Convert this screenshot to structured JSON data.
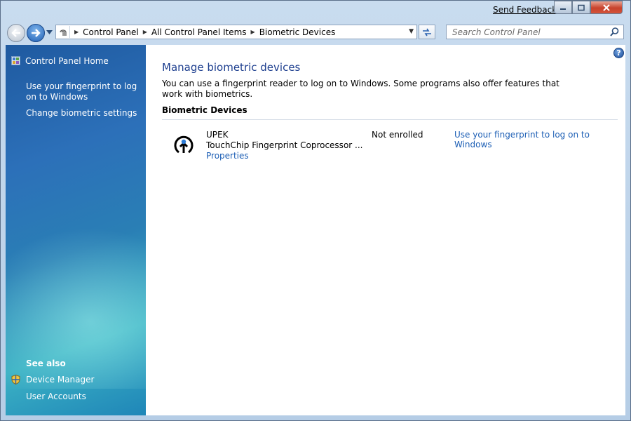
{
  "titlebar": {
    "feedback_label": "Send Feedback"
  },
  "addressbar": {
    "breadcrumbs": [
      "Control Panel",
      "All Control Panel Items",
      "Biometric Devices"
    ]
  },
  "search": {
    "placeholder": "Search Control Panel"
  },
  "sidebar": {
    "home_label": "Control Panel Home",
    "links": [
      "Use your fingerprint to log on to Windows",
      "Change biometric settings"
    ],
    "see_also_heading": "See also",
    "see_also": [
      "Device Manager",
      "User Accounts"
    ]
  },
  "main": {
    "title": "Manage biometric devices",
    "description": "You can use a fingerprint reader to log on to Windows. Some programs also offer features that work with biometrics.",
    "section_heading": "Biometric Devices",
    "device": {
      "vendor": "UPEK",
      "model": "TouchChip Fingerprint Coprocessor ...",
      "properties_label": "Properties",
      "status": "Not enrolled",
      "action_label": "Use your fingerprint to log on to Windows"
    }
  },
  "colors": {
    "link": "#1d5fb5",
    "title": "#1e3f8f",
    "sidebar_top": "#1f5aa0",
    "sidebar_glow": "#3bb1c4"
  }
}
